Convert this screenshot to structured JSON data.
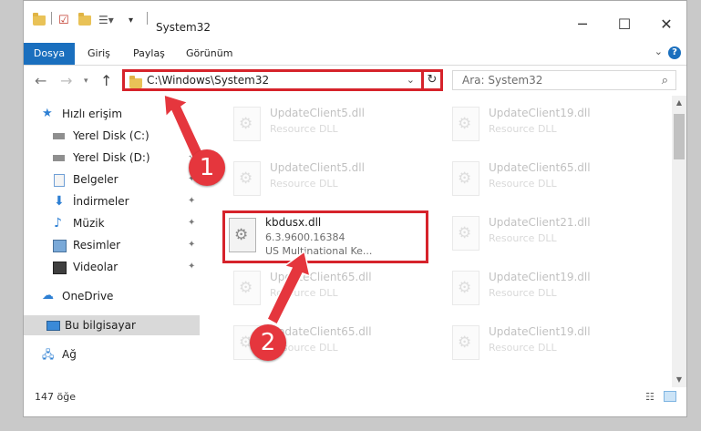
{
  "window": {
    "title": "System32",
    "controls": {
      "minimize": "─",
      "maximize": "☐",
      "close": "✕"
    }
  },
  "ribbon": {
    "tabs": [
      "Dosya",
      "Giriş",
      "Paylaş",
      "Görünüm"
    ],
    "help": "?"
  },
  "address": {
    "path": "C:\\Windows\\System32",
    "search_placeholder": "Ara: System32"
  },
  "sidebar": {
    "items": [
      {
        "label": "Hızlı erişim",
        "icon": "star-icon",
        "pinned": false
      },
      {
        "label": "Yerel Disk (C:)",
        "icon": "drive-icon",
        "pinned": true
      },
      {
        "label": "Yerel Disk (D:)",
        "icon": "drive-icon",
        "pinned": true
      },
      {
        "label": "Belgeler",
        "icon": "documents-icon",
        "pinned": true
      },
      {
        "label": "İndirmeler",
        "icon": "download-icon",
        "pinned": true
      },
      {
        "label": "Müzik",
        "icon": "music-icon",
        "pinned": true
      },
      {
        "label": "Resimler",
        "icon": "pictures-icon",
        "pinned": true
      },
      {
        "label": "Videolar",
        "icon": "videos-icon",
        "pinned": true
      },
      {
        "label": "OneDrive",
        "icon": "cloud-icon",
        "pinned": false
      },
      {
        "label": "Bu bilgisayar",
        "icon": "computer-icon",
        "pinned": false,
        "selected": true
      },
      {
        "label": "Ağ",
        "icon": "network-icon",
        "pinned": false
      }
    ]
  },
  "files": {
    "highlighted": {
      "name": "kbdusx.dll",
      "version": "6.3.9600.16384",
      "description": "US Multinational Ke..."
    },
    "faded": [
      {
        "name": "UpdateClient5.dll",
        "sub": "Resource DLL"
      },
      {
        "name": "UpdateClient19.dll",
        "sub": "Resource DLL"
      },
      {
        "name": "UpdateClient5.dll",
        "sub": "Resource DLL"
      },
      {
        "name": "UpdateClient65.dll",
        "sub": "Resource DLL"
      },
      {
        "name": "UpdateClient21.dll",
        "sub": "Resource DLL"
      },
      {
        "name": "UpdateClient65.dll",
        "sub": "Resource DLL"
      },
      {
        "name": "UpdateClient19.dll",
        "sub": "Resource DLL"
      },
      {
        "name": "UpdateClient65.dll",
        "sub": "Resource DLL"
      },
      {
        "name": "UpdateClient19.dll",
        "sub": "Resource DLL"
      }
    ]
  },
  "status": {
    "count": "147 öğe"
  },
  "annotations": {
    "step1": "1",
    "step2": "2"
  },
  "colors": {
    "accent": "#1a6fbe",
    "highlight": "#d6232b",
    "badge": "#e5363d"
  }
}
